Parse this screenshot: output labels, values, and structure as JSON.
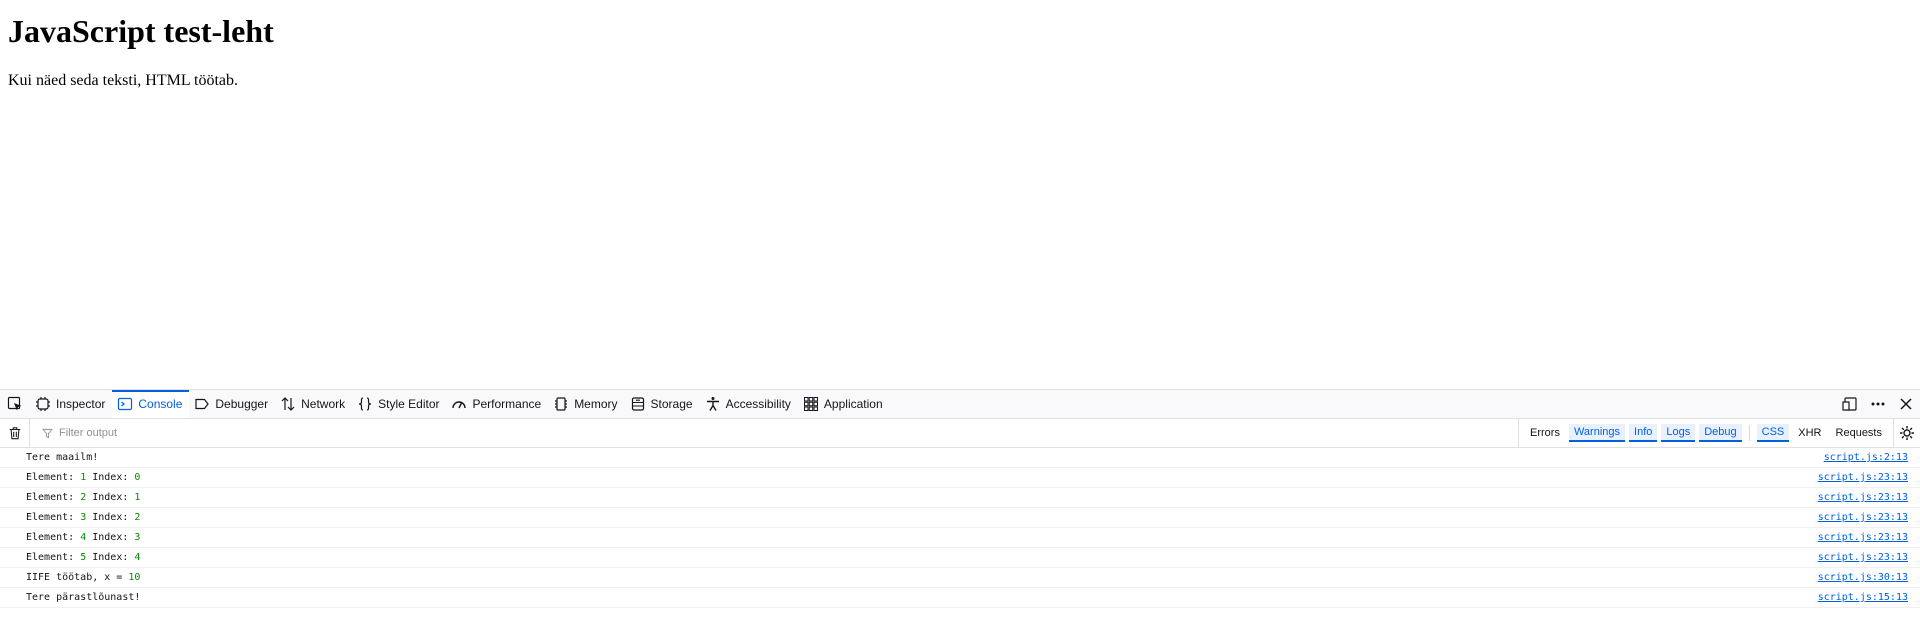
{
  "page": {
    "heading": "JavaScript test-leht",
    "paragraph": "Kui näed seda teksti, HTML töötab."
  },
  "devtools": {
    "tabs": [
      {
        "label": "Inspector",
        "icon": "inspector-icon"
      },
      {
        "label": "Console",
        "icon": "console-icon",
        "selected": true
      },
      {
        "label": "Debugger",
        "icon": "debugger-icon"
      },
      {
        "label": "Network",
        "icon": "network-icon"
      },
      {
        "label": "Style Editor",
        "icon": "style-editor-icon"
      },
      {
        "label": "Performance",
        "icon": "performance-icon"
      },
      {
        "label": "Memory",
        "icon": "memory-icon"
      },
      {
        "label": "Storage",
        "icon": "storage-icon"
      },
      {
        "label": "Accessibility",
        "icon": "accessibility-icon"
      },
      {
        "label": "Application",
        "icon": "application-icon"
      }
    ],
    "filter_placeholder": "Filter output",
    "filters": {
      "errors": "Errors",
      "warnings": "Warnings",
      "info": "Info",
      "logs": "Logs",
      "debug": "Debug",
      "css": "CSS",
      "xhr": "XHR",
      "requests": "Requests"
    },
    "messages": [
      {
        "parts": [
          {
            "t": "Tere maailm!"
          }
        ],
        "location": "script.js:2:13"
      },
      {
        "parts": [
          {
            "t": "Element: "
          },
          {
            "t": "1",
            "num": true
          },
          {
            "t": " Index: "
          },
          {
            "t": "0",
            "num": true
          }
        ],
        "location": "script.js:23:13"
      },
      {
        "parts": [
          {
            "t": "Element: "
          },
          {
            "t": "2",
            "num": true
          },
          {
            "t": " Index: "
          },
          {
            "t": "1",
            "num": true
          }
        ],
        "location": "script.js:23:13"
      },
      {
        "parts": [
          {
            "t": "Element: "
          },
          {
            "t": "3",
            "num": true
          },
          {
            "t": " Index: "
          },
          {
            "t": "2",
            "num": true
          }
        ],
        "location": "script.js:23:13"
      },
      {
        "parts": [
          {
            "t": "Element: "
          },
          {
            "t": "4",
            "num": true
          },
          {
            "t": " Index: "
          },
          {
            "t": "3",
            "num": true
          }
        ],
        "location": "script.js:23:13"
      },
      {
        "parts": [
          {
            "t": "Element: "
          },
          {
            "t": "5",
            "num": true
          },
          {
            "t": " Index: "
          },
          {
            "t": "4",
            "num": true
          }
        ],
        "location": "script.js:23:13"
      },
      {
        "parts": [
          {
            "t": "IIFE töötab, x = "
          },
          {
            "t": "10",
            "num": true
          }
        ],
        "location": "script.js:30:13"
      },
      {
        "parts": [
          {
            "t": "Tere pärastlõunast!"
          }
        ],
        "location": "script.js:15:13"
      }
    ]
  }
}
